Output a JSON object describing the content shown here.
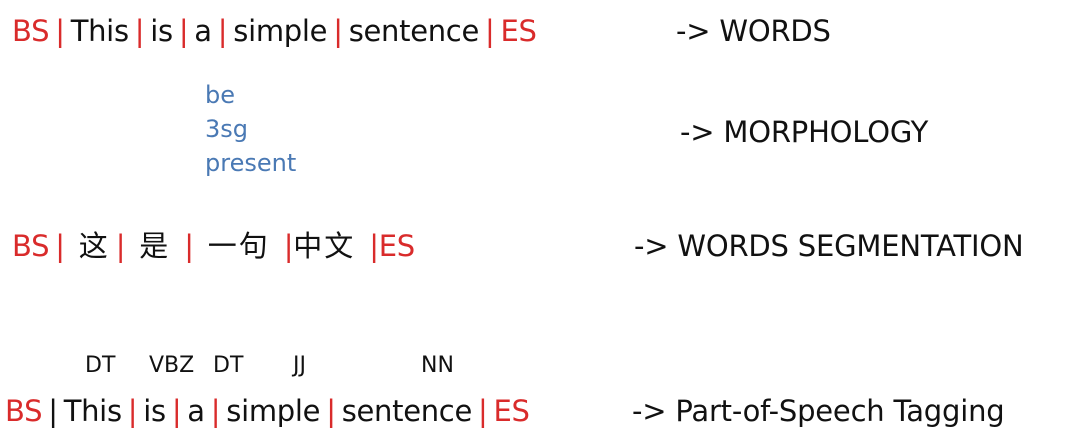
{
  "row1": {
    "bs": "BS",
    "tokens": [
      "This",
      "is",
      "a",
      "simple",
      "sentence"
    ],
    "es": "ES",
    "sep": "|",
    "label": "->  WORDS"
  },
  "morph": {
    "lines": [
      "be",
      "3sg",
      "present"
    ],
    "label": "->  MORPHOLOGY"
  },
  "row3": {
    "bs": "BS",
    "tokens": [
      "这",
      "是",
      "一句",
      "中文"
    ],
    "es": "ES",
    "sep": "|",
    "label": "->  WORDS SEGMENTATION"
  },
  "pos": {
    "tags": [
      "DT",
      "VBZ",
      "DT",
      "JJ",
      "NN"
    ],
    "bs": "BS",
    "tokens": [
      "This",
      "is",
      "a",
      "simple",
      "sentence"
    ],
    "es": "ES",
    "sep": "|",
    "label": "->  Part-of-Speech Tagging"
  },
  "colors": {
    "marker": "#d92b2b",
    "morph_text": "#4a79b4",
    "text": "#111111"
  }
}
